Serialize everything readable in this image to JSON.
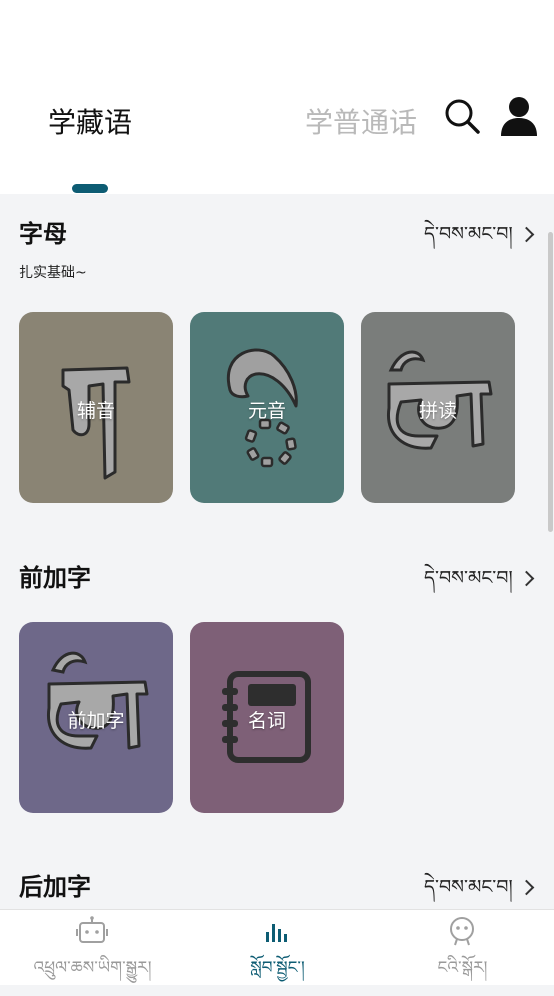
{
  "header": {
    "active_tab": "学藏语",
    "other_tab": "学普通话"
  },
  "sections": {
    "letters": {
      "title": "字母",
      "subtitle": "扎实基础~",
      "more": "དེ་བས་མང་བ།",
      "cards": [
        {
          "label": "辅音",
          "color": "#8a8474"
        },
        {
          "label": "元音",
          "color": "#517a78"
        },
        {
          "label": "拼读",
          "color": "#7a7d7b"
        }
      ]
    },
    "prefix": {
      "title": "前加字",
      "more": "དེ་བས་མང་བ།",
      "cards": [
        {
          "label": "前加字",
          "color": "#6e6889"
        },
        {
          "label": "名词",
          "color": "#7e6077"
        }
      ]
    },
    "suffix": {
      "title": "后加字",
      "more": "དེ་བས་མང་བ།"
    }
  },
  "nav": {
    "items": [
      {
        "label": "འཕྲུལ་ཆས་ཡིག་སྒྱུར།",
        "icon": "robot-icon"
      },
      {
        "label": "སློབ་སྦྱོང་།",
        "icon": "bar-chart-icon"
      },
      {
        "label": "ངའི་སྒོར།",
        "icon": "face-icon"
      }
    ],
    "active_color": "#0d5c73",
    "inactive_color": "#9a9a9a"
  }
}
